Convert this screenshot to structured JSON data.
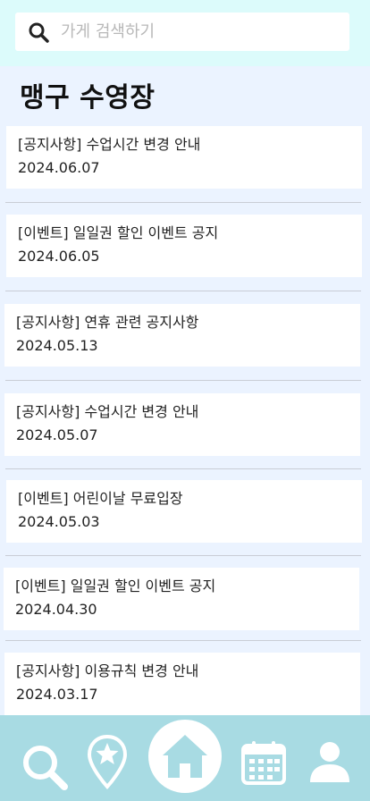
{
  "search": {
    "placeholder": "가게 검색하기"
  },
  "page_title": "맹구 수영장",
  "notices": [
    {
      "title": "[공지사항] 수업시간 변경 안내",
      "date": "2024.06.07"
    },
    {
      "title": "[이벤트] 일일권 할인 이벤트 공지",
      "date": "2024.06.05"
    },
    {
      "title": "[공지사항] 연휴 관련 공지사항",
      "date": "2024.05.13"
    },
    {
      "title": "[공지사항] 수업시간 변경 안내",
      "date": "2024.05.07"
    },
    {
      "title": "[이벤트] 어린이날 무료입장",
      "date": "2024.05.03"
    },
    {
      "title": "[이벤트] 일일권 할인 이벤트 공지",
      "date": "2024.04.30"
    },
    {
      "title": "[공지사항] 이용규칙 변경 안내",
      "date": "2024.03.17"
    }
  ],
  "bottom_nav": [
    {
      "icon": "search-icon",
      "active": false
    },
    {
      "icon": "star-pin-icon",
      "active": false
    },
    {
      "icon": "home-icon",
      "active": true
    },
    {
      "icon": "calendar-icon",
      "active": false
    },
    {
      "icon": "user-icon",
      "active": false
    }
  ],
  "colors": {
    "background": "#ebf3ff",
    "top_bar": "#dcfbfb",
    "bottom_nav": "#a8dbe3",
    "icon": "#ffffff"
  }
}
